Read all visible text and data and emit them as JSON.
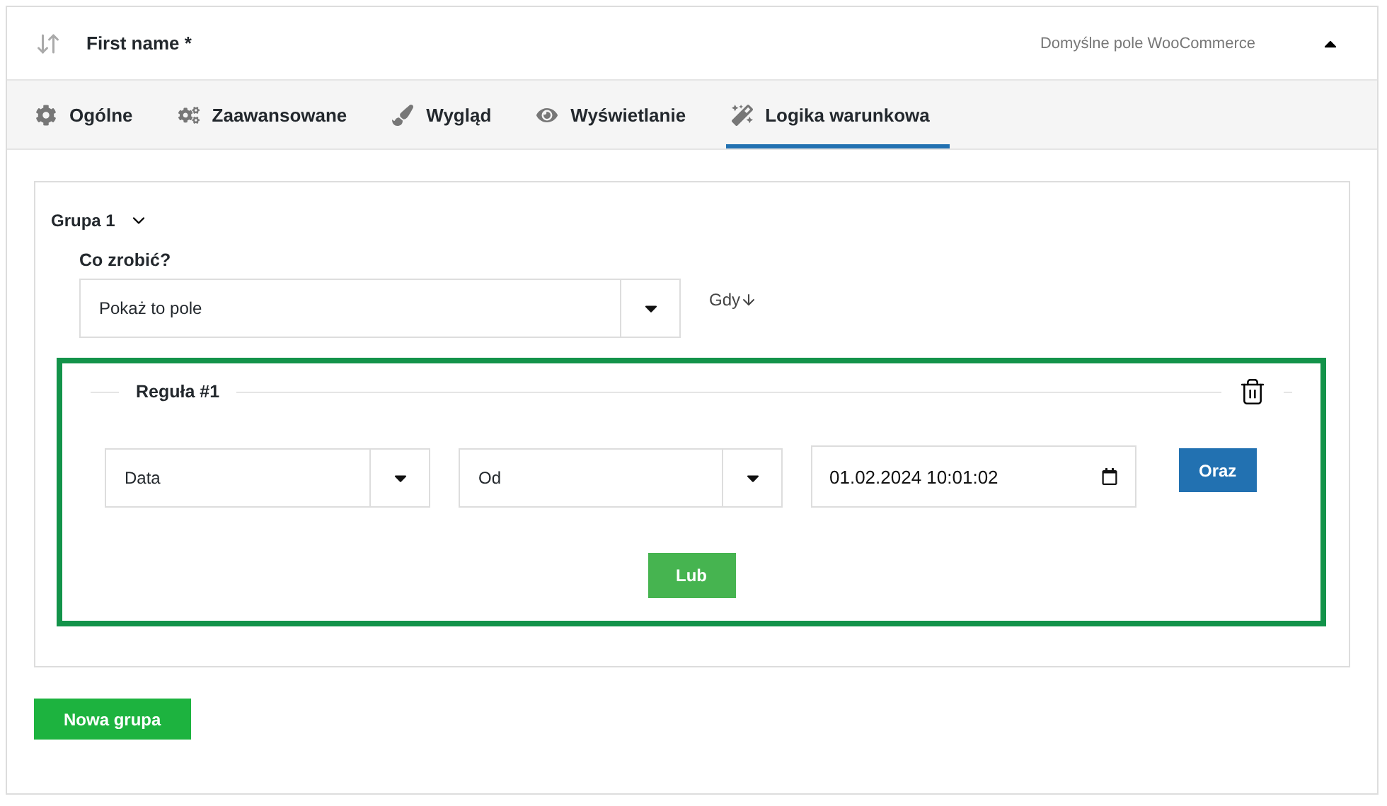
{
  "field_header": {
    "title": "First name *",
    "source": "Domyślne pole WooCommerce",
    "expanded": true
  },
  "tabs": [
    {
      "label": "Ogólne",
      "selected": false
    },
    {
      "label": "Zaawansowane",
      "selected": false
    },
    {
      "label": "Wygląd",
      "selected": false
    },
    {
      "label": "Wyświetlanie",
      "selected": false
    },
    {
      "label": "Logika warunkowa",
      "selected": true
    }
  ],
  "group": {
    "title": "Grupa 1",
    "expanded": true,
    "action_label": "Co zrobić?",
    "action_value": "Pokaż to pole",
    "when_label": "Gdy",
    "rules": [
      {
        "title": "Reguła #1",
        "field": "Data",
        "operator": "Od",
        "value": "01.02.2024 10:01:02",
        "and_button": "Oraz"
      }
    ],
    "or_button": "Lub"
  },
  "new_group_button": "Nowa grupa"
}
